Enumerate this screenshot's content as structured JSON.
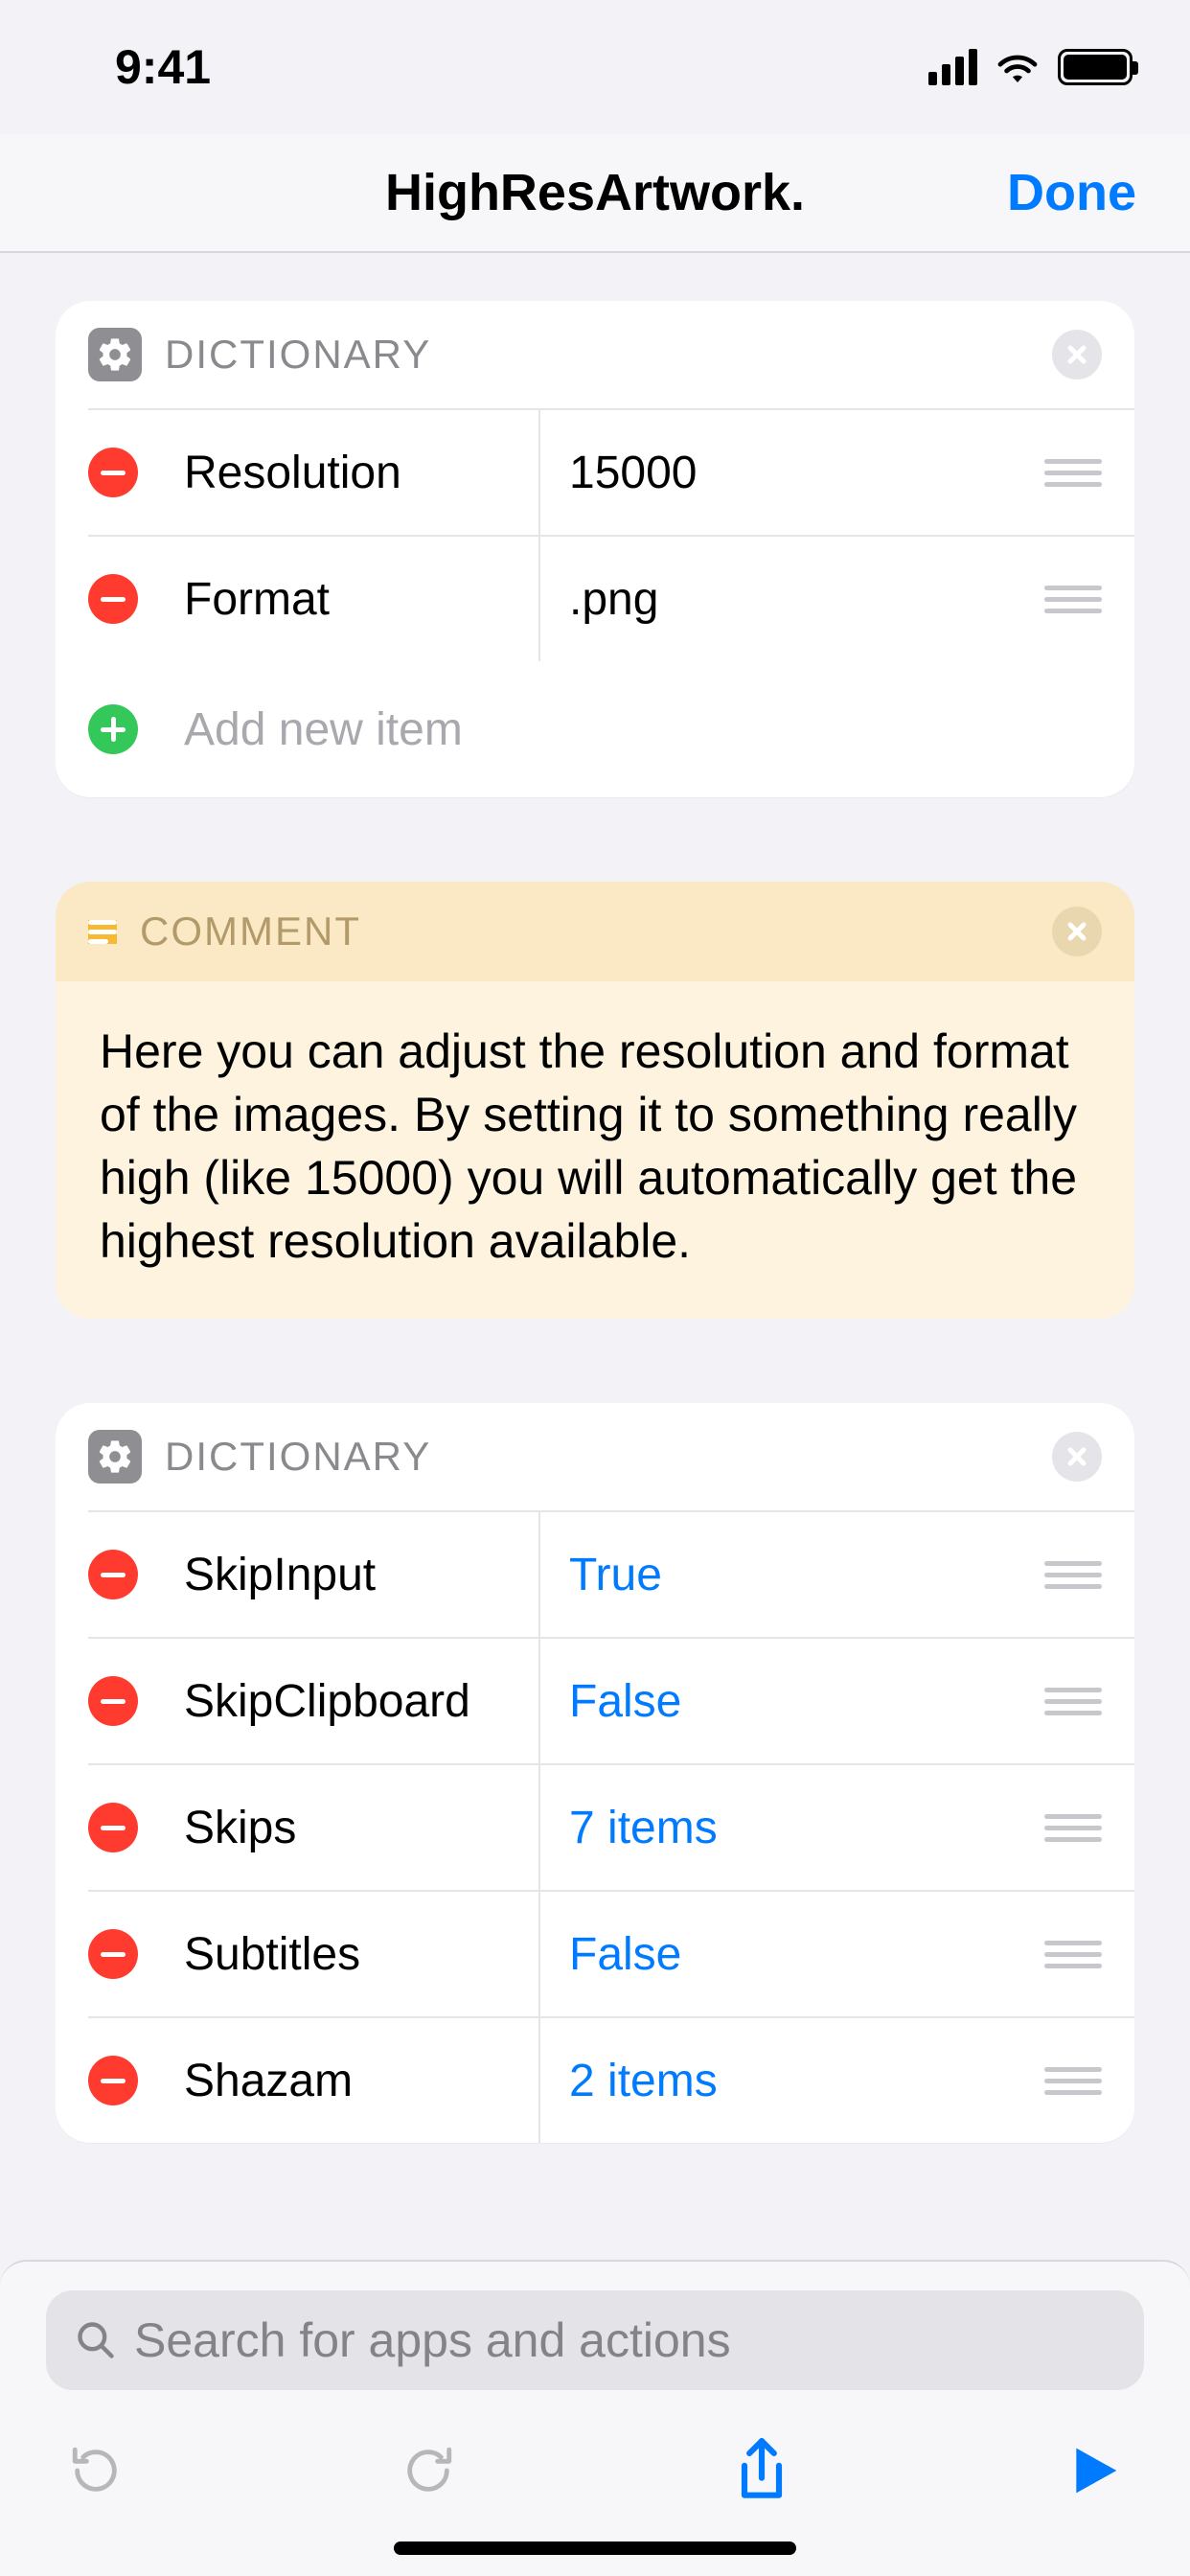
{
  "status": {
    "time": "9:41"
  },
  "nav": {
    "title": "HighResArtwork.",
    "done": "Done"
  },
  "dict1": {
    "header": "DICTIONARY",
    "rows": [
      {
        "key": "Resolution",
        "value": "15000",
        "value_is_token": false
      },
      {
        "key": "Format",
        "value": ".png",
        "value_is_token": false
      }
    ],
    "add_placeholder": "Add new item"
  },
  "comment": {
    "header": "COMMENT",
    "body": "Here you can adjust the resolution and format of the images. By setting it to something really high (like 15000) you will automatically get the highest resolution available."
  },
  "dict2": {
    "header": "DICTIONARY",
    "rows": [
      {
        "key": "SkipInput",
        "value": "True",
        "value_is_token": true
      },
      {
        "key": "SkipClipboard",
        "value": "False",
        "value_is_token": true
      },
      {
        "key": "Skips",
        "value": "7 items",
        "value_is_token": true
      },
      {
        "key": "Subtitles",
        "value": "False",
        "value_is_token": true
      },
      {
        "key": "Shazam",
        "value": "2 items",
        "value_is_token": true
      }
    ]
  },
  "search": {
    "placeholder": "Search for apps and actions"
  }
}
